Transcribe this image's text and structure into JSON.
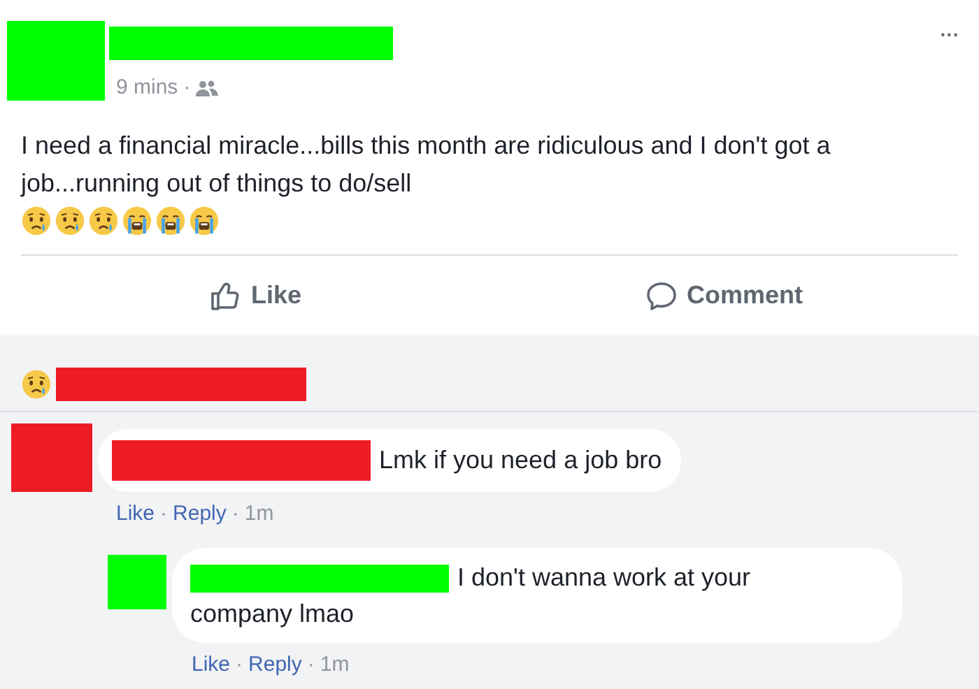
{
  "post": {
    "time": "9 mins",
    "separator": "·",
    "more": "...",
    "text": "I need a financial miracle...bills this month are ridiculous and I don't got a job...running out of things to do/sell",
    "emojis": [
      {
        "kind": "sad"
      },
      {
        "kind": "sad"
      },
      {
        "kind": "sad"
      },
      {
        "kind": "sob"
      },
      {
        "kind": "sob"
      },
      {
        "kind": "sob"
      }
    ],
    "actions": [
      {
        "kind": "like",
        "label": "Like"
      },
      {
        "kind": "comment",
        "label": "Comment"
      }
    ]
  },
  "reactions": {
    "kind": "sad"
  },
  "comments": [
    {
      "color": "#ed1c24",
      "text": "Lmk if you need a job bro",
      "actions": [
        "Like",
        "Reply"
      ],
      "separator": "·",
      "time": "1m",
      "children": [
        {
          "color": "#00ff00",
          "text": "I don't wanna work at your company lmao",
          "actions": [
            "Like",
            "Reply"
          ],
          "separator": "·",
          "time": "1m"
        }
      ]
    }
  ]
}
